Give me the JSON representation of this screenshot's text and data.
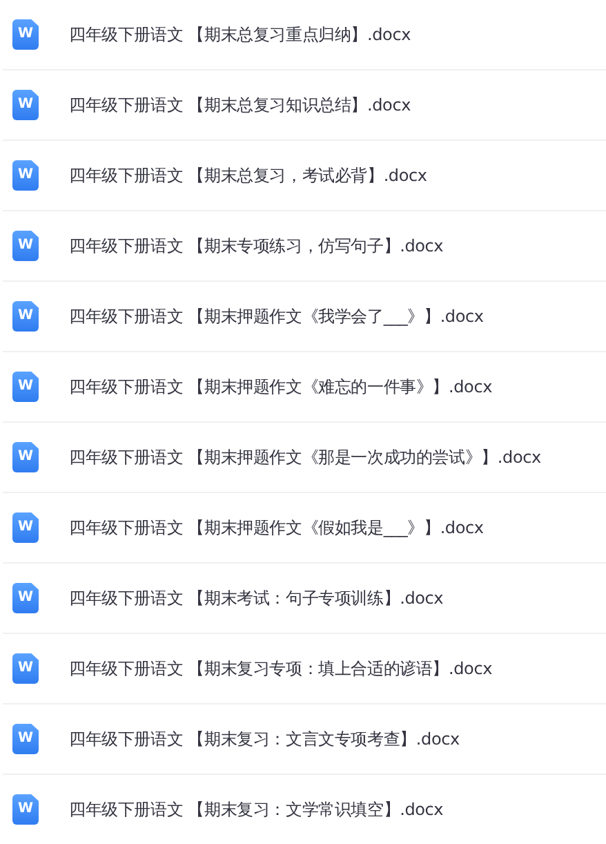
{
  "files": [
    {
      "icon_text": "W",
      "name": "四年级下册语文 【期末总复习重点归纳】.docx"
    },
    {
      "icon_text": "W",
      "name": "四年级下册语文 【期末总复习知识总结】.docx"
    },
    {
      "icon_text": "W",
      "name": "四年级下册语文 【期末总复习，考试必背】.docx"
    },
    {
      "icon_text": "W",
      "name": "四年级下册语文 【期末专项练习，仿写句子】.docx"
    },
    {
      "icon_text": "W",
      "name": "四年级下册语文 【期末押题作文《我学会了___》】.docx"
    },
    {
      "icon_text": "W",
      "name": "四年级下册语文 【期末押题作文《难忘的一件事》】.docx"
    },
    {
      "icon_text": "W",
      "name": "四年级下册语文 【期末押题作文《那是一次成功的尝试》】.docx"
    },
    {
      "icon_text": "W",
      "name": "四年级下册语文 【期末押题作文《假如我是___》】.docx"
    },
    {
      "icon_text": "W",
      "name": "四年级下册语文 【期末考试：句子专项训练】.docx"
    },
    {
      "icon_text": "W",
      "name": "四年级下册语文 【期末复习专项：填上合适的谚语】.docx"
    },
    {
      "icon_text": "W",
      "name": "四年级下册语文 【期末复习：文言文专项考查】.docx"
    },
    {
      "icon_text": "W",
      "name": "四年级下册语文 【期末复习：文学常识填空】.docx"
    }
  ]
}
